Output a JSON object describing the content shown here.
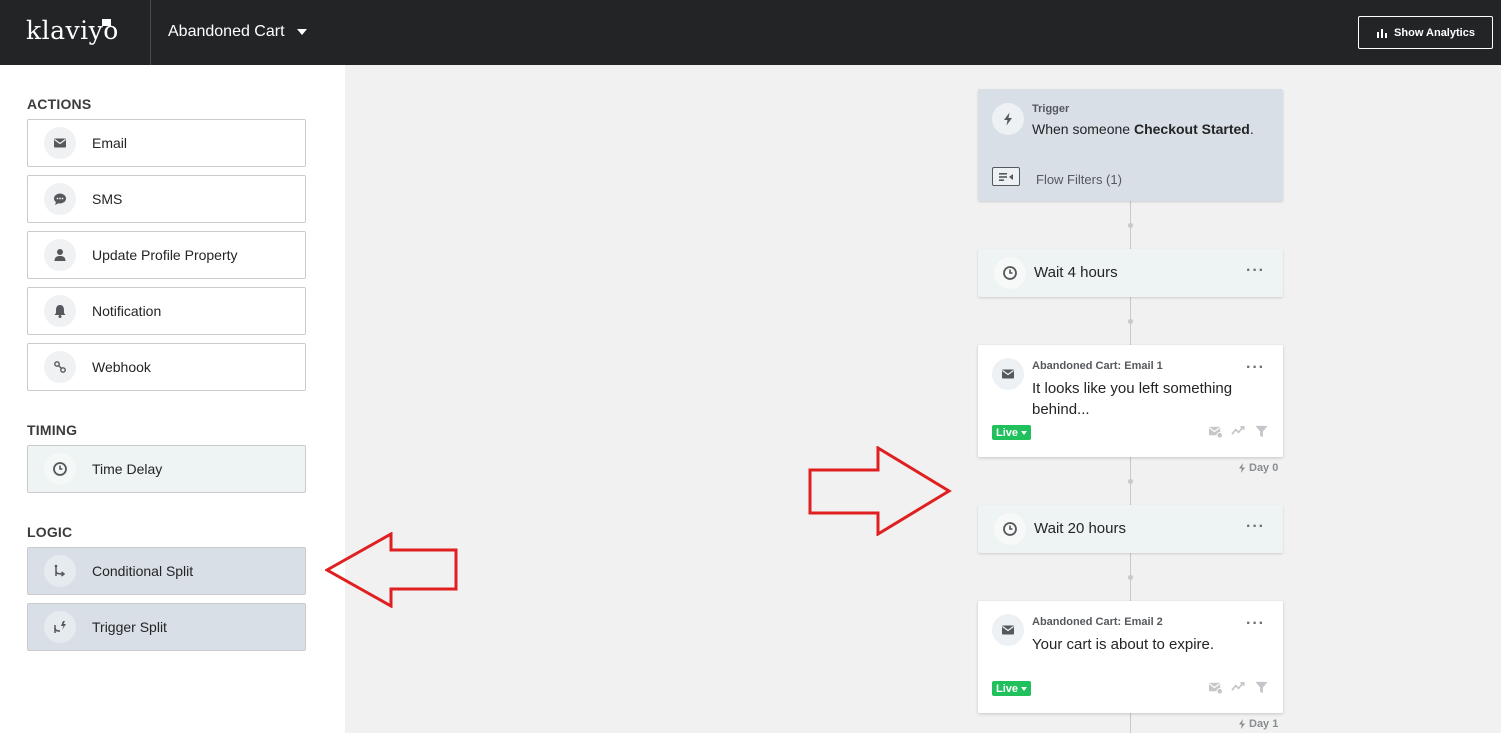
{
  "app": {
    "logo": "klaviyo",
    "flow_name": "Abandoned Cart",
    "show_analytics_label": "Show Analytics"
  },
  "sidebar": {
    "actions_title": "ACTIONS",
    "actions": [
      {
        "label": "Email",
        "icon": "envelope-icon"
      },
      {
        "label": "SMS",
        "icon": "chat-bubble-icon"
      },
      {
        "label": "Update Profile Property",
        "icon": "person-icon"
      },
      {
        "label": "Notification",
        "icon": "bell-icon"
      },
      {
        "label": "Webhook",
        "icon": "webhook-icon"
      }
    ],
    "timing_title": "TIMING",
    "timing": [
      {
        "label": "Time Delay",
        "icon": "clock-icon"
      }
    ],
    "logic_title": "LOGIC",
    "logic": [
      {
        "label": "Conditional Split",
        "icon": "split-arrow-icon"
      },
      {
        "label": "Trigger Split",
        "icon": "trigger-split-icon"
      }
    ]
  },
  "flow": {
    "trigger": {
      "label": "Trigger",
      "prefix": "When someone",
      "event": "Checkout Started",
      "suffix": ".",
      "filters": "Flow Filters (1)"
    },
    "wait_1": {
      "label": "Wait 4 hours"
    },
    "email_1": {
      "name": "Abandoned Cart: Email 1",
      "subject": "It looks like you left something behind...",
      "status": "Live",
      "day": "Day 0"
    },
    "wait_2": {
      "label": "Wait 20 hours"
    },
    "email_2": {
      "name": "Abandoned Cart: Email 2",
      "subject": "Your cart is about to expire.",
      "status": "Live",
      "day": "Day 1"
    },
    "menu_glyph": "···"
  },
  "colors": {
    "topbar": "#232426",
    "live": "#20c05c",
    "annotation_arrow": "#e02020",
    "trigger_card": "#d8dfe6",
    "wait_card": "#eef4f3"
  }
}
